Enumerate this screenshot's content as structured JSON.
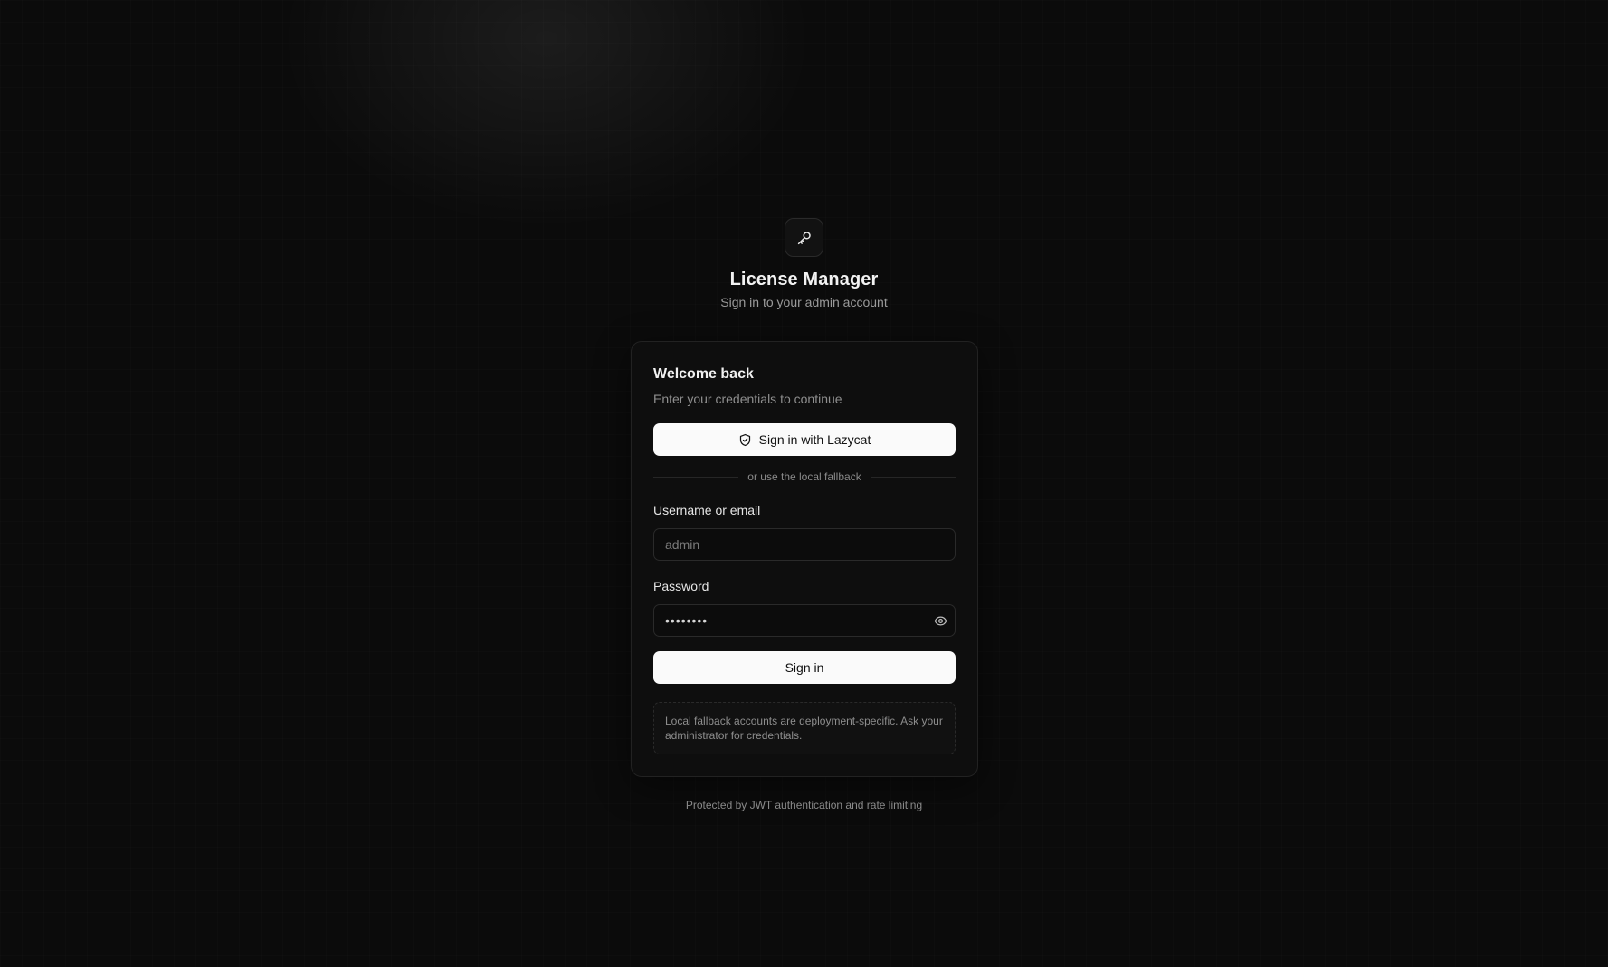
{
  "header": {
    "logo_icon": "key-icon",
    "title": "License Manager",
    "subtitle": "Sign in to your admin account"
  },
  "card": {
    "title": "Welcome back",
    "subtitle": "Enter your credentials to continue",
    "sso_button": {
      "icon": "shield-check-icon",
      "label": "Sign in with Lazycat"
    },
    "divider_text": "or use the local fallback",
    "username": {
      "label": "Username or email",
      "placeholder": "admin",
      "value": ""
    },
    "password": {
      "label": "Password",
      "value": "••••••••",
      "toggle_icon": "eye-icon"
    },
    "submit_label": "Sign in",
    "note": "Local fallback accounts are deployment-specific. Ask your administrator for credentials."
  },
  "footer": {
    "text": "Protected by JWT authentication and rate limiting"
  },
  "colors": {
    "background": "#0b0b0b",
    "card_background": "#0e0e0e",
    "primary_button": "#fafafa",
    "primary_button_text": "#111111",
    "muted_text": "#8f8f8f"
  }
}
